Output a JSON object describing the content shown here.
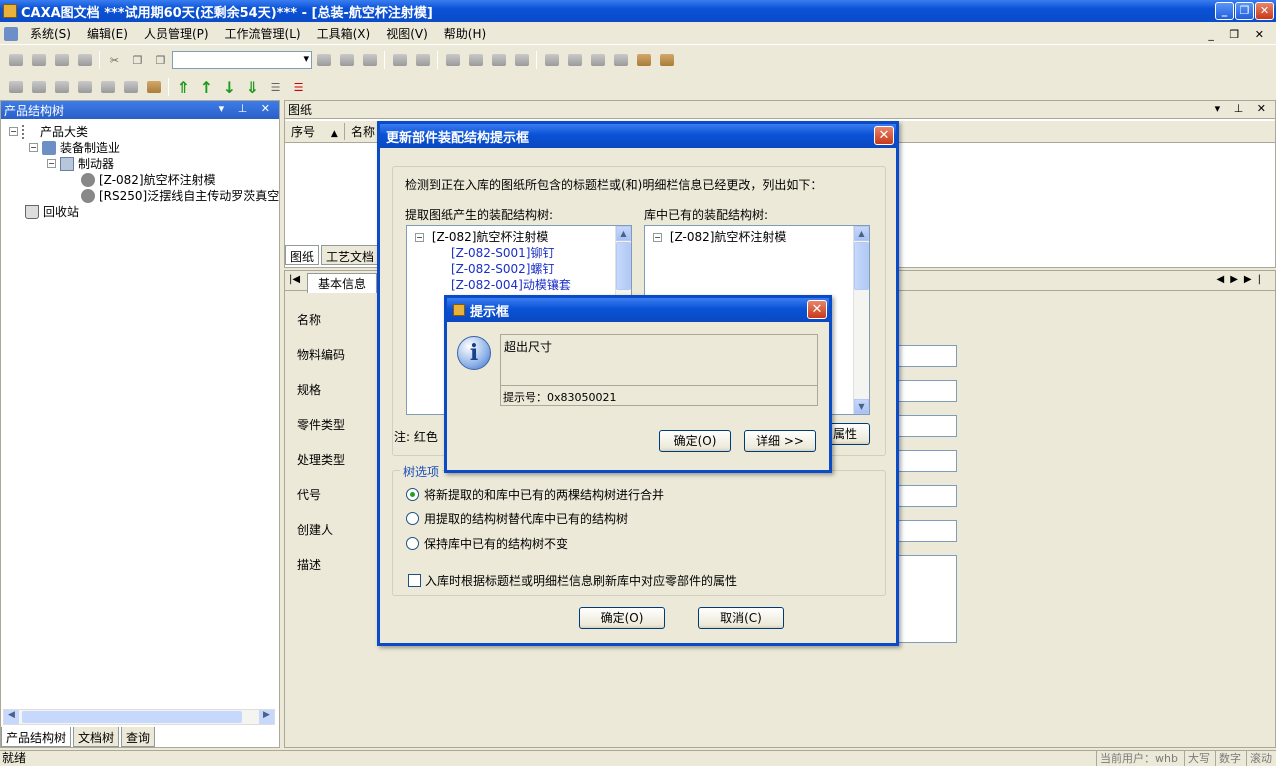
{
  "window": {
    "title": "CAXA图文档    ***试用期60天(还剩余54天)*** - [总装-航空杯注射模]",
    "controls": [
      "_",
      "❐",
      "✕"
    ]
  },
  "menu": [
    "系统(S)",
    "编辑(E)",
    "人员管理(P)",
    "工作流管理(L)",
    "工具箱(X)",
    "视图(V)",
    "帮助(H)"
  ],
  "mdi_controls": "_ ❐ ✕",
  "left_panel": {
    "title": "产品结构树",
    "tree": [
      {
        "label": "产品大类"
      },
      {
        "label": "装备制造业"
      },
      {
        "label": "制动器"
      },
      {
        "label": "[Z-082]航空杯注射模"
      },
      {
        "label": "[RS250]泛摆线自主传动罗茨真空"
      },
      {
        "label": "回收站"
      }
    ],
    "tabs": [
      "产品结构树",
      "文档树",
      "查询"
    ]
  },
  "drawings_panel": {
    "title": "图纸",
    "columns": [
      "序号",
      "名称"
    ],
    "sort_indicator": "▲",
    "tabs": [
      "图纸",
      "工艺文档"
    ]
  },
  "detail_panel": {
    "tab": "基本信息",
    "fields": [
      "名称",
      "物料编码",
      "规格",
      "零件类型",
      "处理类型",
      "代号",
      "创建人",
      "描述"
    ]
  },
  "status": {
    "left": "就绪",
    "user": "当前用户：whb",
    "caps": "大写",
    "num": "数字",
    "scroll": "滚动"
  },
  "update_dialog": {
    "title": "更新部件装配结构提示框",
    "description": "检测到正在入库的图纸所包含的标题栏或(和)明细栏信息已经更改，列出如下：",
    "left_label": "提取图纸产生的装配结构树:",
    "right_label": "库中已有的装配结构树:",
    "left_tree": [
      "[Z-082]航空杯注射模",
      "[Z-082-S001]铆钉",
      "[Z-082-S002]螺钉",
      "[Z-082-004]动模镶套"
    ],
    "right_tree": [
      "[Z-082]航空杯注射模"
    ],
    "note": "注: 红色",
    "attr_button": "属性",
    "tree_options_label": "树选项",
    "options": [
      "将新提取的和库中已有的两棵结构树进行合并",
      "用提取的结构树替代库中已有的结构树",
      "保持库中已有的结构树不变"
    ],
    "selected_option": 0,
    "refresh_checkbox": "入库时根据标题栏或明细栏信息刷新库中对应零部件的属性",
    "ok": "确定(O)",
    "cancel": "取消(C)"
  },
  "prompt_dialog": {
    "title": "提示框",
    "message": "超出尺寸",
    "code": "提示号：0x83050021",
    "ok": "确定(O)",
    "details": "详细 >>"
  }
}
